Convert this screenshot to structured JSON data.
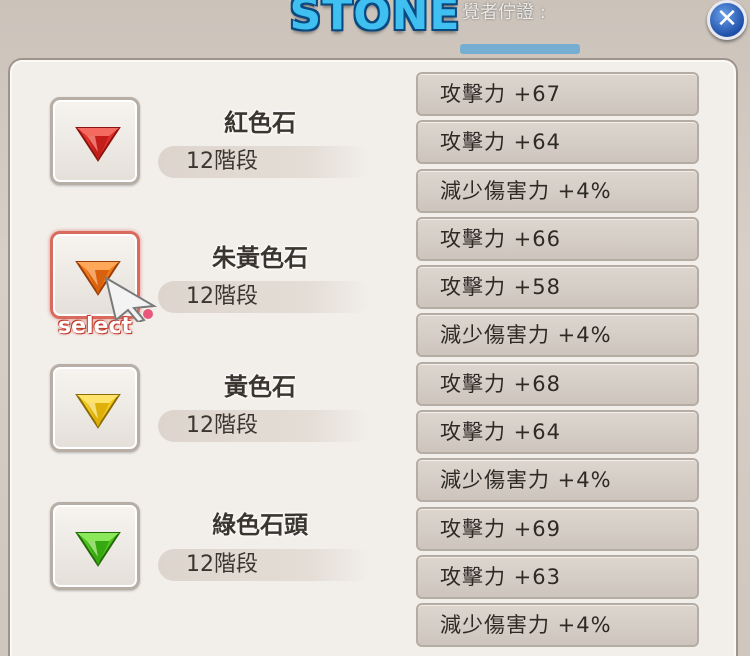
{
  "window": {
    "banner_title": "STONE",
    "top_note": "覺者佇證 :",
    "close_label": "✕"
  },
  "colors": {
    "red_gem": "#e0302a",
    "orange_gem": "#f07a1a",
    "yellow_gem": "#f2c81a",
    "green_gem": "#4cc41c",
    "selected_border": "#d96a5e"
  },
  "selection": {
    "tag": "select",
    "selected_index": 1
  },
  "stones": [
    {
      "name": "紅色石",
      "stage": "12階段",
      "icon": "red-gem-icon",
      "stats": [
        "攻擊力 +67",
        "攻擊力 +64",
        "減少傷害力 +4%"
      ]
    },
    {
      "name": "朱黃色石",
      "stage": "12階段",
      "icon": "orange-gem-icon",
      "stats": [
        "攻擊力 +66",
        "攻擊力 +58",
        "減少傷害力 +4%"
      ]
    },
    {
      "name": "黃色石",
      "stage": "12階段",
      "icon": "yellow-gem-icon",
      "stats": [
        "攻擊力 +68",
        "攻擊力 +64",
        "減少傷害力 +4%"
      ]
    },
    {
      "name": "綠色石頭",
      "stage": "12階段",
      "icon": "green-gem-icon",
      "stats": [
        "攻擊力 +69",
        "攻擊力 +63",
        "減少傷害力 +4%"
      ]
    }
  ]
}
